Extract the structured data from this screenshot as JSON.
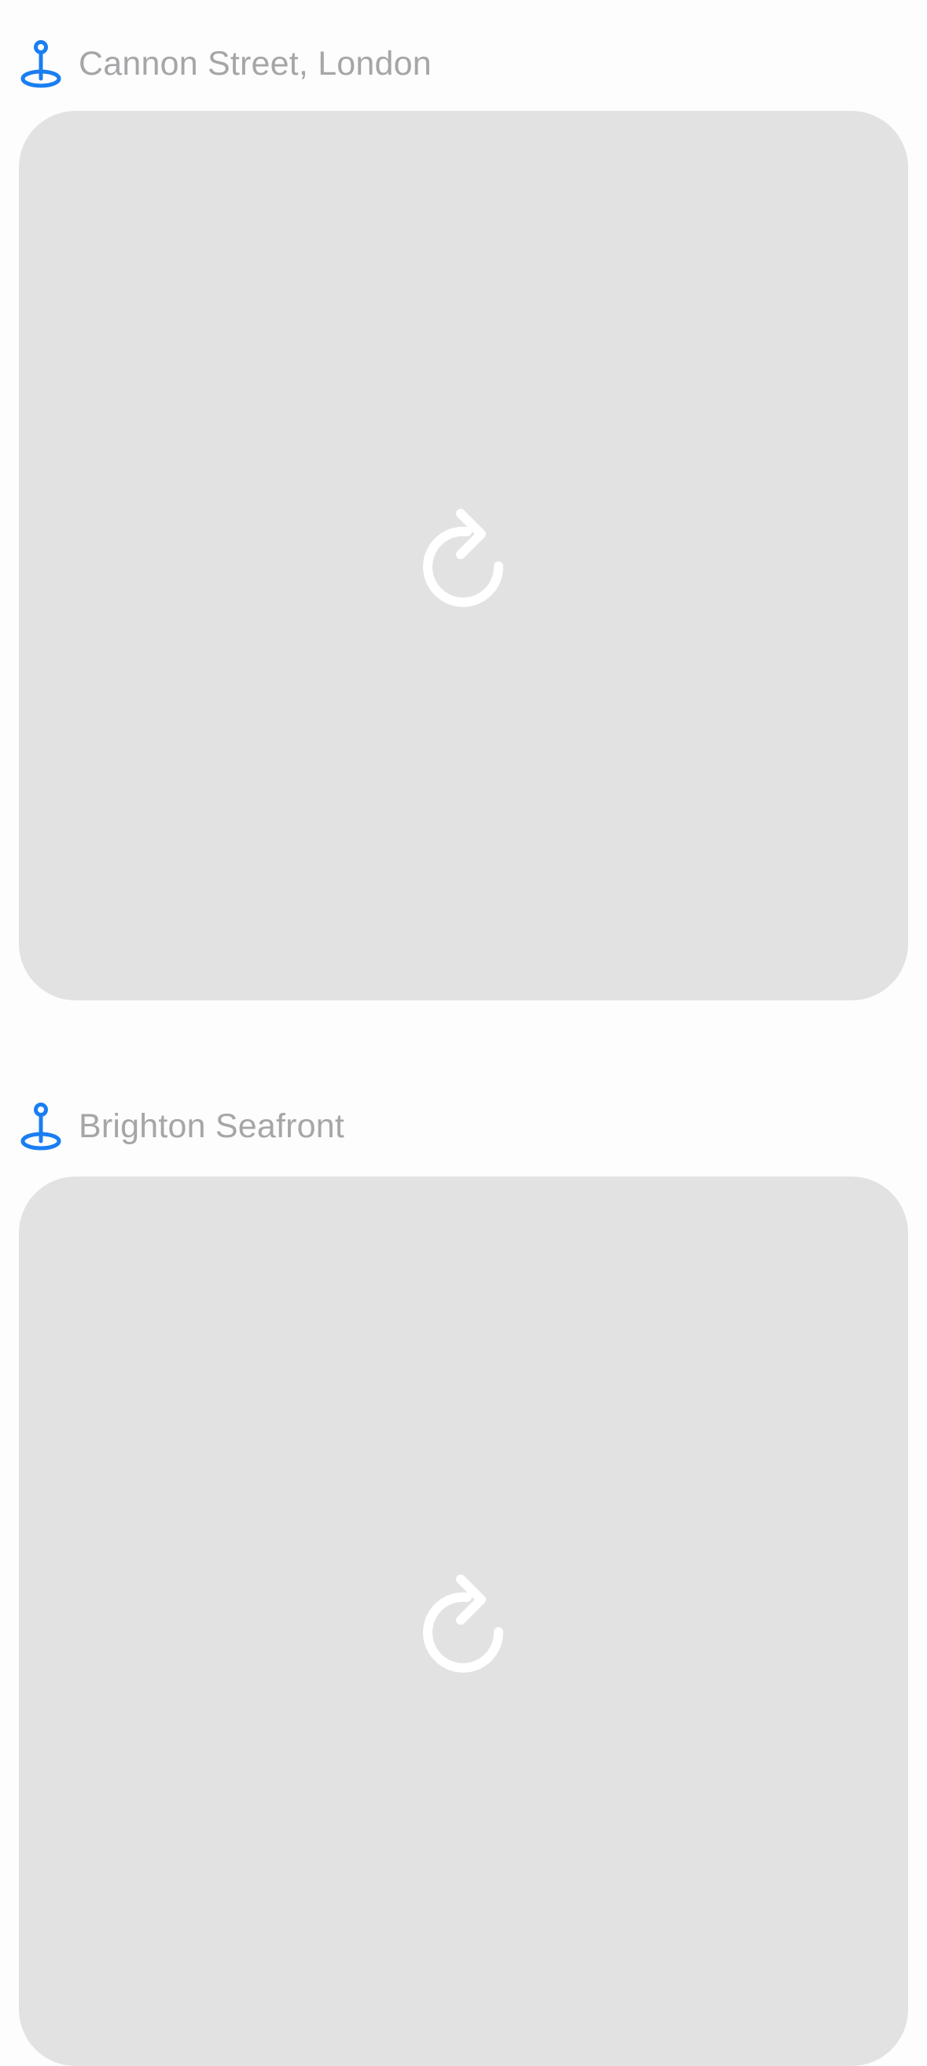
{
  "colors": {
    "background": "#fdfdfd",
    "location_text": "#a6a6a9",
    "pin_accent": "#1a7ef2",
    "card_placeholder": "#e2e2e2",
    "reload_glyph": "#ffffff"
  },
  "feed": {
    "posts": [
      {
        "location": "Cannon Street, London",
        "location_icon": "map-pin-icon",
        "media_state_icon": "reload-icon"
      },
      {
        "location": "Brighton Seafront",
        "location_icon": "map-pin-icon",
        "media_state_icon": "reload-icon"
      }
    ]
  }
}
